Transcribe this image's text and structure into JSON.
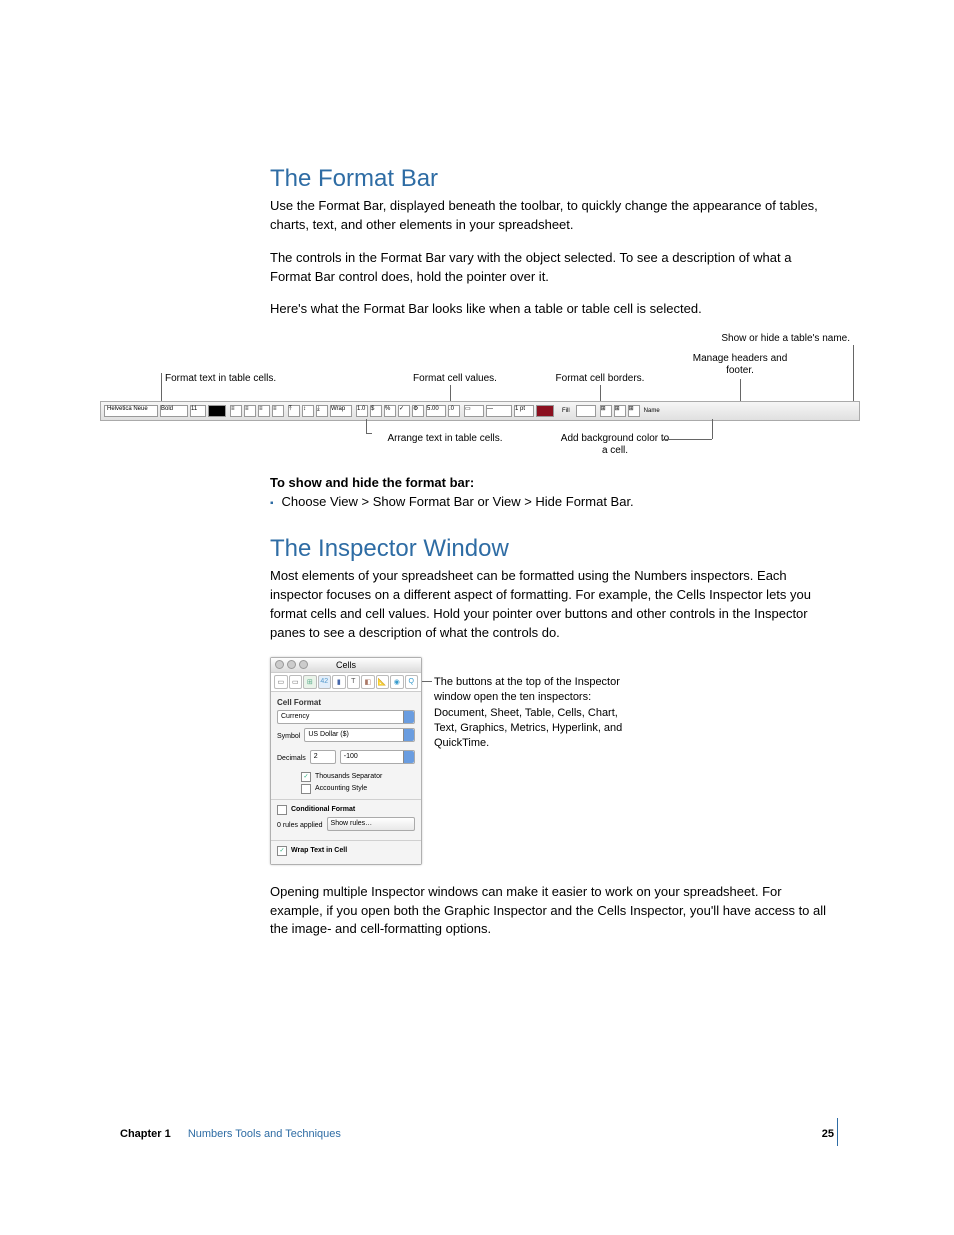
{
  "section1": {
    "heading": "The Format Bar",
    "p1": "Use the Format Bar, displayed beneath the toolbar, to quickly change the appearance of tables, charts, text, and other elements in your spreadsheet.",
    "p2": "The controls in the Format Bar vary with the object selected. To see a description of what a Format Bar control does, hold the pointer over it.",
    "p3": "Here's what the Format Bar looks like when a table or table cell is selected."
  },
  "formatbar": {
    "callouts": {
      "showhide": "Show or hide a table's name.",
      "manage": "Manage headers and footer.",
      "formatText": "Format text in table cells.",
      "formatValues": "Format cell values.",
      "formatBorders": "Format cell borders.",
      "arrange": "Arrange text in table cells.",
      "background": "Add background color to a cell."
    },
    "controls": {
      "font": "Helvetica Neue",
      "style": "Bold",
      "size": "11",
      "wrap": "Wrap",
      "decimalsExample": "1.0",
      "currency": "$",
      "percent": "%",
      "check": "✓",
      "gear": "⚙",
      "sample": "5.00",
      "decButtons": ".0→ ←.0",
      "border": "1 pt",
      "fill": "Fill",
      "name": "Name"
    }
  },
  "instructions": {
    "subhead": "To show and hide the format bar:",
    "bullet": "Choose View > Show Format Bar or View > Hide Format Bar."
  },
  "section2": {
    "heading": "The Inspector Window",
    "p1": "Most elements of your spreadsheet can be formatted using the Numbers inspectors. Each inspector focuses on a different aspect of formatting. For example, the Cells Inspector lets you format cells and cell values. Hold your pointer over buttons and other controls in the Inspector panes to see a description of what the controls do."
  },
  "inspector": {
    "title": "Cells",
    "sectionLabel": "Cell Format",
    "select1": "Currency",
    "symbolLabel": "Symbol",
    "symbol": "US Dollar ($)",
    "decimalsLabel": "Decimals",
    "decimals": "2",
    "negSample": "-100",
    "thousands": "Thousands Separator",
    "accounting": "Accounting Style",
    "conditional": "Conditional Format",
    "rulesApplied": "0 rules applied",
    "showRules": "Show rules…",
    "wrapText": "Wrap Text in Cell",
    "sideText": "The buttons at the top of the Inspector window open the ten inspectors:  Document, Sheet, Table, Cells, Chart, Text, Graphics, Metrics, Hyperlink, and QuickTime."
  },
  "section2b": {
    "p2": "Opening multiple Inspector windows can make it easier to work on your spreadsheet. For example, if you open both the Graphic Inspector and the Cells Inspector, you'll have access to all the image- and cell-formatting options."
  },
  "footer": {
    "chapter": "Chapter 1",
    "title": "Numbers Tools and Techniques",
    "page": "25"
  }
}
